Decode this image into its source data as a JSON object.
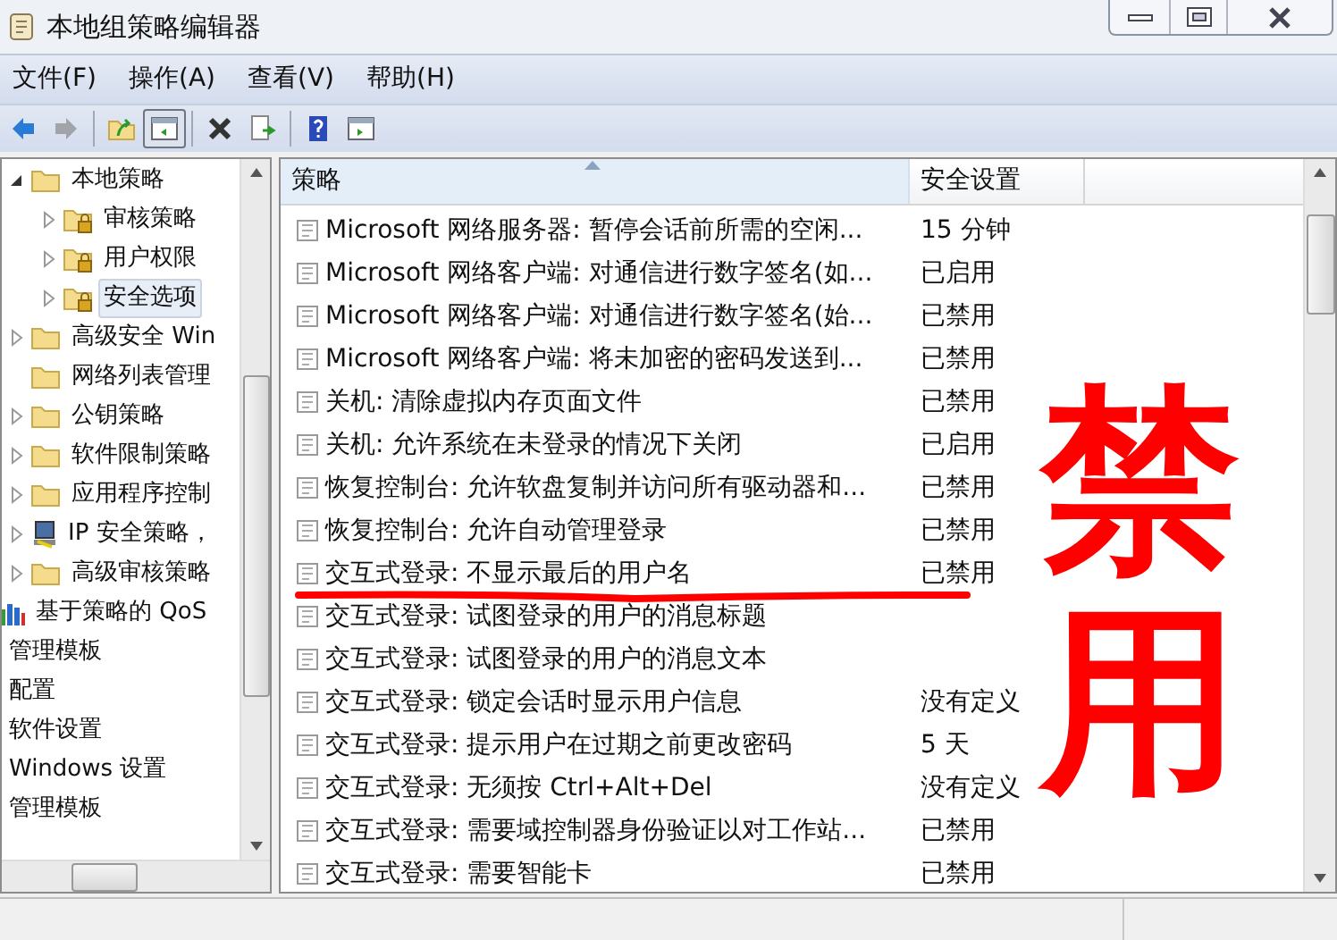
{
  "window": {
    "title": "本地组策略编辑器"
  },
  "menu": [
    {
      "label": "文件(F)"
    },
    {
      "label": "操作(A)"
    },
    {
      "label": "查看(V)"
    },
    {
      "label": "帮助(H)"
    }
  ],
  "toolbar": [
    {
      "kind": "back",
      "disabled": false,
      "pressed": false
    },
    {
      "kind": "forward",
      "disabled": true,
      "pressed": false
    },
    {
      "kind": "sep"
    },
    {
      "kind": "up",
      "disabled": false,
      "pressed": false
    },
    {
      "kind": "tree",
      "disabled": false,
      "pressed": true
    },
    {
      "kind": "sep"
    },
    {
      "kind": "delete",
      "disabled": false,
      "pressed": false
    },
    {
      "kind": "export",
      "disabled": false,
      "pressed": false
    },
    {
      "kind": "sep"
    },
    {
      "kind": "help",
      "disabled": false,
      "pressed": false
    },
    {
      "kind": "pane",
      "disabled": false,
      "pressed": false
    }
  ],
  "tree": [
    {
      "children": [
        {
          "children": [
            {
              "label": "本地策略",
              "kind": "folder",
              "expanded": true,
              "selected": false,
              "children": [
                {
                  "label": "审核策略",
                  "kind": "locked",
                  "expanded": false,
                  "selected": false
                },
                {
                  "label": "用户权限",
                  "kind": "locked",
                  "expanded": false,
                  "selected": false
                },
                {
                  "label": "安全选项",
                  "kind": "locked",
                  "expanded": false,
                  "selected": true
                }
              ]
            },
            {
              "label": "高级安全 Win",
              "kind": "folder",
              "expanded": false,
              "selected": false
            },
            {
              "label": "网络列表管理",
              "kind": "folder",
              "selected": false
            },
            {
              "label": "公钥策略",
              "kind": "folder",
              "expanded": false,
              "selected": false
            },
            {
              "label": "软件限制策略",
              "kind": "folder",
              "expanded": false,
              "selected": false
            },
            {
              "label": "应用程序控制",
              "kind": "folder",
              "expanded": false,
              "selected": false
            },
            {
              "label": "IP 安全策略，",
              "kind": "computer",
              "expanded": false,
              "selected": false
            },
            {
              "label": "高级审核策略",
              "kind": "folder",
              "expanded": false,
              "selected": false
            }
          ]
        },
        {
          "label": "基于策略的 QoS",
          "kind": "chart",
          "selected": false
        }
      ]
    },
    {
      "label": "管理模板",
      "selected": false
    },
    {
      "label": "配置",
      "selected": false
    },
    {
      "label": "软件设置",
      "selected": false
    },
    {
      "label": "Windows 设置",
      "selected": false
    },
    {
      "label": "管理模板",
      "selected": false
    }
  ],
  "table": {
    "columns": [
      {
        "label": "策略",
        "sorted": true
      },
      {
        "label": "安全设置",
        "sorted": false
      }
    ],
    "rows": [
      {
        "policy": "Microsoft 网络服务器: 暂停会话前所需的空闲...",
        "setting": "15 分钟"
      },
      {
        "policy": "Microsoft 网络客户端: 对通信进行数字签名(如...",
        "setting": "已启用"
      },
      {
        "policy": "Microsoft 网络客户端: 对通信进行数字签名(始...",
        "setting": "已禁用"
      },
      {
        "policy": "Microsoft 网络客户端: 将未加密的密码发送到...",
        "setting": "已禁用"
      },
      {
        "policy": "关机: 清除虚拟内存页面文件",
        "setting": "已禁用"
      },
      {
        "policy": "关机: 允许系统在未登录的情况下关闭",
        "setting": "已启用"
      },
      {
        "policy": "恢复控制台: 允许软盘复制并访问所有驱动器和...",
        "setting": "已禁用"
      },
      {
        "policy": "恢复控制台: 允许自动管理登录",
        "setting": "已禁用"
      },
      {
        "policy": "交互式登录: 不显示最后的用户名",
        "setting": "已禁用"
      },
      {
        "policy": "交互式登录: 试图登录的用户的消息标题"
      },
      {
        "policy": "交互式登录: 试图登录的用户的消息文本"
      },
      {
        "policy": "交互式登录: 锁定会话时显示用户信息",
        "setting": "没有定义"
      },
      {
        "policy": "交互式登录: 提示用户在过期之前更改密码",
        "setting": "5 天"
      },
      {
        "policy": "交互式登录: 无须按 Ctrl+Alt+Del",
        "setting": "没有定义"
      },
      {
        "policy": "交互式登录: 需要域控制器身份验证以对工作站...",
        "setting": "已禁用"
      },
      {
        "policy": "交互式登录: 需要智能卡",
        "setting": "已禁用"
      }
    ]
  },
  "annotation": {
    "text": "禁用"
  }
}
